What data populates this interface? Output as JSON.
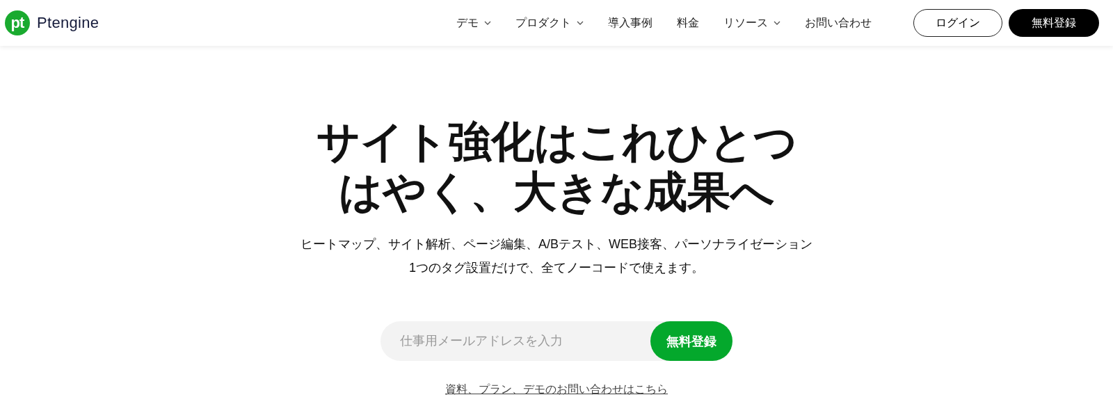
{
  "header": {
    "logo": {
      "mark": "pt",
      "name": "Ptengine"
    },
    "nav": [
      {
        "label": "デモ",
        "has_dropdown": true
      },
      {
        "label": "プロダクト",
        "has_dropdown": true
      },
      {
        "label": "導入事例",
        "has_dropdown": false
      },
      {
        "label": "料金",
        "has_dropdown": false
      },
      {
        "label": "リソース",
        "has_dropdown": true
      },
      {
        "label": "お問い合わせ",
        "has_dropdown": false
      }
    ],
    "login_button": "ログイン",
    "signup_button": "無料登録"
  },
  "hero": {
    "headline": [
      "サイト強化はこれひとつ",
      "はやく、大きな成果へ"
    ],
    "subtitle": [
      "ヒートマップ、サイト解析、ページ編集、A/Bテスト、WEB接客、パーソナライゼーション",
      "1つのタグ設置だけで、全てノーコードで使えます。"
    ],
    "email_field": {
      "placeholder": "仕事用メールアドレスを入力"
    },
    "submit_button": "無料登録",
    "contact_link": "資料、プラン、デモのお問い合わせはこちら"
  }
}
